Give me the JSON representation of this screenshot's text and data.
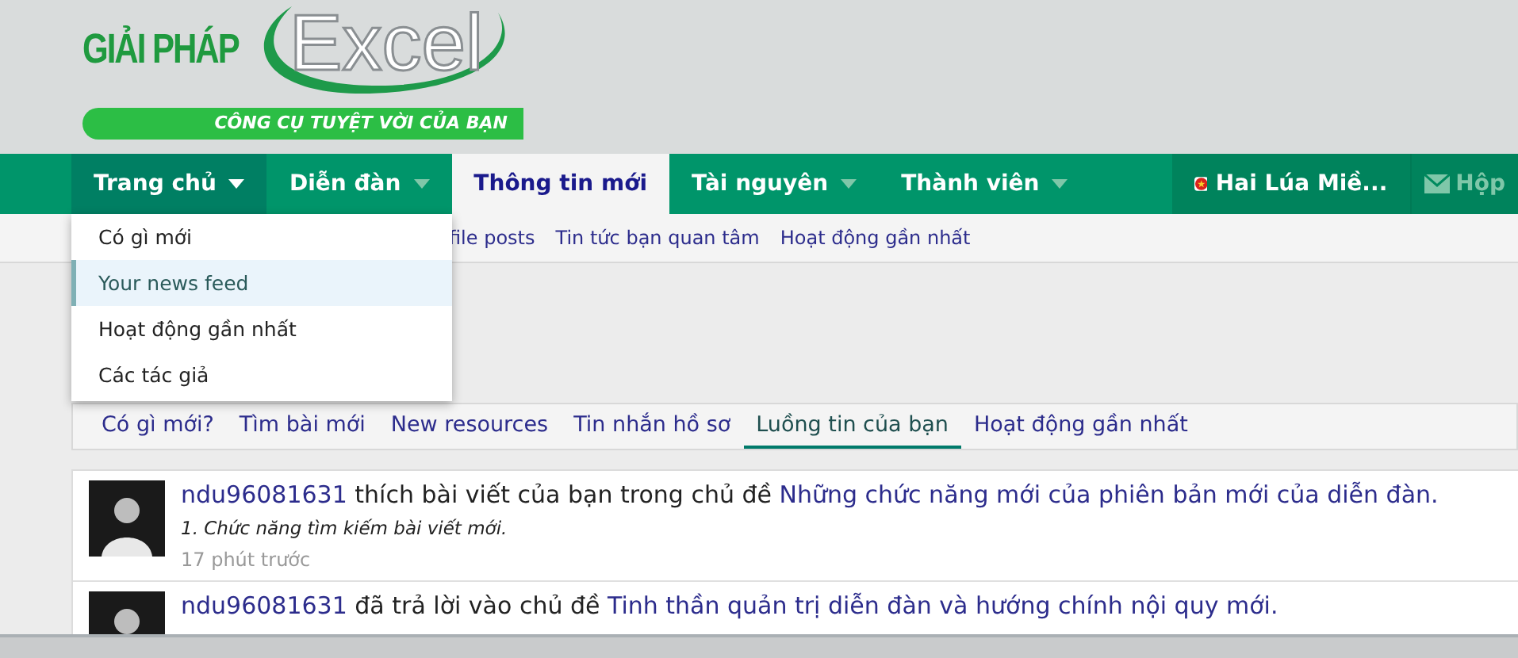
{
  "logo": {
    "brand": "GIẢI PHÁP",
    "product": "Excel",
    "tagline": "CÔNG CỤ TUYỆT VỜI CỦA BẠN"
  },
  "nav": [
    {
      "label": "Trang chủ",
      "selected": false,
      "open": true,
      "dropdown": true
    },
    {
      "label": "Diễn đàn",
      "selected": false,
      "open": false,
      "dropdown": true
    },
    {
      "label": "Thông tin mới",
      "selected": true,
      "open": false,
      "dropdown": false
    },
    {
      "label": "Tài nguyên",
      "selected": false,
      "open": false,
      "dropdown": true
    },
    {
      "label": "Thành viên",
      "selected": false,
      "open": false,
      "dropdown": true
    }
  ],
  "user": {
    "name": "Hai Lúa Miề...",
    "inbox": "Hộp"
  },
  "subnav": [
    "file posts",
    "Tin tức bạn quan tâm",
    "Hoạt động gần nhất"
  ],
  "menu": [
    {
      "label": "Có gì mới",
      "selected": false
    },
    {
      "label": "Your news feed",
      "selected": true
    },
    {
      "label": "Hoạt động gần nhất",
      "selected": false
    },
    {
      "label": "Các tác giả",
      "selected": false
    }
  ],
  "tabs": [
    {
      "label": "Có gì mới?",
      "selected": false
    },
    {
      "label": "Tìm bài mới",
      "selected": false
    },
    {
      "label": "New resources",
      "selected": false
    },
    {
      "label": "Tin nhắn hồ sơ",
      "selected": false
    },
    {
      "label": "Luồng tin của bạn",
      "selected": true
    },
    {
      "label": "Hoạt động gần nhất",
      "selected": false
    }
  ],
  "feed": [
    {
      "user": "ndu96081631",
      "action": "thích bài viết của bạn trong chủ đề",
      "thread": "Những chức năng mới của phiên bản mới của diễn đàn.",
      "snippet": "1. Chức năng tìm kiếm bài viết mới.",
      "time": "17 phút trước"
    },
    {
      "user": "ndu96081631",
      "action": "đã trả lời vào chủ đề",
      "thread": "Tinh thần quản trị diễn đàn và hướng chính nội quy mới."
    }
  ]
}
